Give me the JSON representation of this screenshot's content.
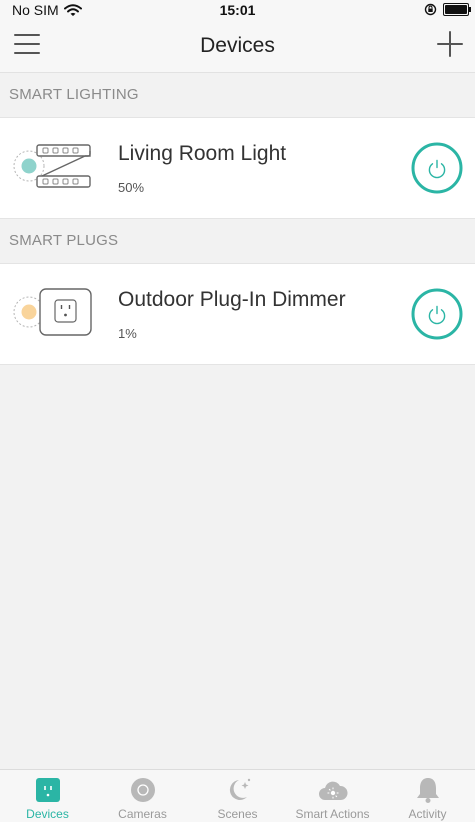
{
  "status_bar": {
    "carrier": "No SIM",
    "time": "15:01"
  },
  "header": {
    "title": "Devices"
  },
  "sections": [
    {
      "title": "SMART LIGHTING",
      "devices": [
        {
          "name": "Living Room Light",
          "status": "50%",
          "icon": "light-strip-icon",
          "indicator_color": "#8fd3cc"
        }
      ]
    },
    {
      "title": "SMART PLUGS",
      "devices": [
        {
          "name": "Outdoor Plug-In Dimmer",
          "status": "1%",
          "icon": "plug-icon",
          "indicator_color": "#f9d49b"
        }
      ]
    }
  ],
  "tabs": [
    {
      "label": "Devices",
      "icon": "devices-icon",
      "active": true
    },
    {
      "label": "Cameras",
      "icon": "camera-icon",
      "active": false
    },
    {
      "label": "Scenes",
      "icon": "moon-stars-icon",
      "active": false
    },
    {
      "label": "Smart Actions",
      "icon": "cloud-sun-icon",
      "active": false
    },
    {
      "label": "Activity",
      "icon": "bell-icon",
      "active": false
    }
  ],
  "colors": {
    "accent": "#2bb5a5",
    "tab_inactive": "#b8b8b8"
  }
}
